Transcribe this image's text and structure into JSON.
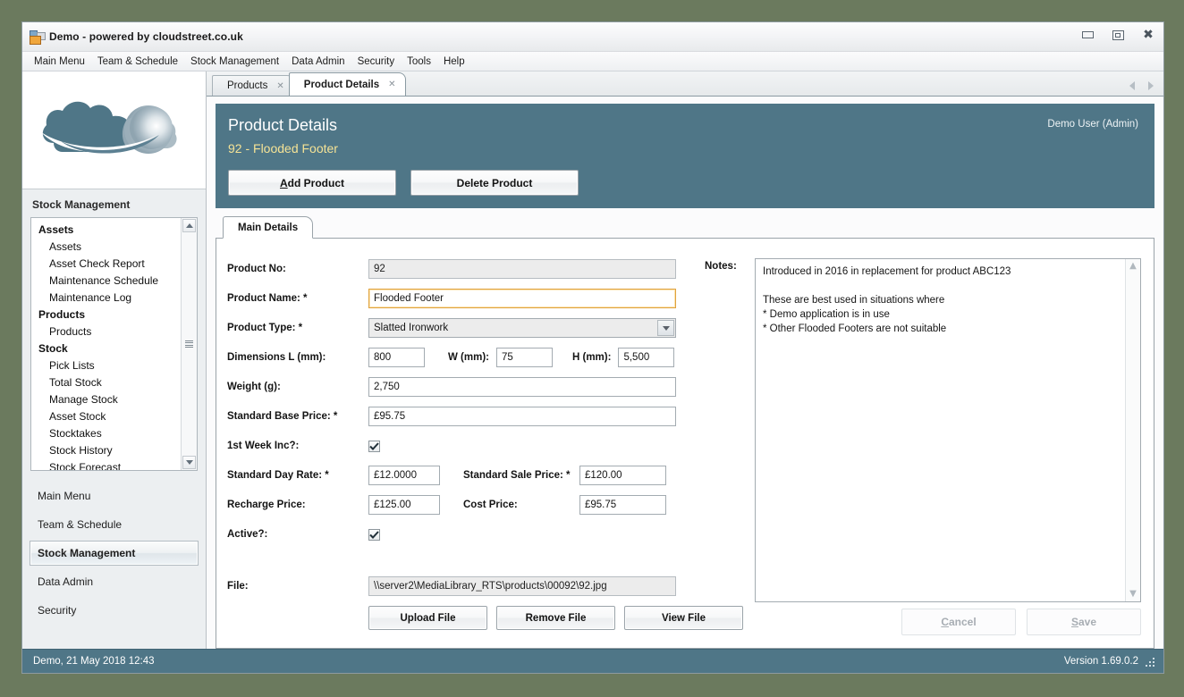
{
  "window": {
    "title": "Demo - powered by cloudstreet.co.uk",
    "app_icon": "app-window-icon",
    "minimize": "minimize-icon",
    "restore": "restore-icon",
    "close": "close-icon"
  },
  "menubar": {
    "items": [
      {
        "label": "Main Menu"
      },
      {
        "label": "Team & Schedule"
      },
      {
        "label": "Stock Management"
      },
      {
        "label": "Data Admin"
      },
      {
        "label": "Security"
      },
      {
        "label": "Tools"
      },
      {
        "label": "Help"
      }
    ]
  },
  "tabs": {
    "items": [
      {
        "label": "Products",
        "active": false,
        "close": "✕"
      },
      {
        "label": "Product Details",
        "active": true,
        "close": "✕"
      }
    ],
    "nav_prev": "chevron-left-icon",
    "nav_next": "chevron-right-icon"
  },
  "sidebar": {
    "logo": "cloudstreet-cloud-logo",
    "section_heading": "Stock Management",
    "tree": [
      {
        "label": "Assets",
        "type": "group"
      },
      {
        "label": "Assets",
        "type": "child"
      },
      {
        "label": "Asset Check Report",
        "type": "child"
      },
      {
        "label": "Maintenance Schedule",
        "type": "child"
      },
      {
        "label": "Maintenance Log",
        "type": "child"
      },
      {
        "label": "Products",
        "type": "group"
      },
      {
        "label": "Products",
        "type": "child"
      },
      {
        "label": "Stock",
        "type": "group"
      },
      {
        "label": "Pick Lists",
        "type": "child"
      },
      {
        "label": "Total Stock",
        "type": "child"
      },
      {
        "label": "Manage Stock",
        "type": "child"
      },
      {
        "label": "Asset Stock",
        "type": "child"
      },
      {
        "label": "Stocktakes",
        "type": "child"
      },
      {
        "label": "Stock History",
        "type": "child"
      },
      {
        "label": "Stock Forecast",
        "type": "child"
      }
    ],
    "nav": [
      {
        "label": "Main Menu",
        "selected": false
      },
      {
        "label": "Team & Schedule",
        "selected": false
      },
      {
        "label": "Stock Management",
        "selected": true
      },
      {
        "label": "Data Admin",
        "selected": false
      },
      {
        "label": "Security",
        "selected": false
      }
    ]
  },
  "header": {
    "title": "Product Details",
    "subtitle": "92 - Flooded Footer",
    "user": "Demo User (Admin)",
    "add_button": "Add Product",
    "add_button_accel": "A",
    "add_button_rest": "dd Product",
    "delete_button": "Delete Product",
    "accent_color": "#4f7687",
    "subtitle_color": "#f5e396"
  },
  "panel": {
    "tab_label": "Main Details"
  },
  "form": {
    "product_no": {
      "label": "Product No:",
      "value": "92"
    },
    "product_name": {
      "label": "Product Name: *",
      "value": "Flooded Footer"
    },
    "product_type": {
      "label": "Product Type: *",
      "value": "Slatted Ironwork"
    },
    "dimensions": {
      "label": "Dimensions L (mm):",
      "length": "800",
      "width_label": "W (mm):",
      "width": "75",
      "height_label": "H (mm):",
      "height": "5,500"
    },
    "weight": {
      "label": "Weight (g):",
      "value": "2,750"
    },
    "base_price": {
      "label": "Standard Base Price: *",
      "value": "£95.75"
    },
    "first_week_inc": {
      "label": "1st Week Inc?:",
      "checked": true
    },
    "day_rate": {
      "label": "Standard Day Rate: *",
      "value": "£12.0000"
    },
    "sale_price": {
      "label": "Standard Sale Price: *",
      "value": "£120.00"
    },
    "recharge_price": {
      "label": "Recharge Price:",
      "value": "£125.00"
    },
    "cost_price": {
      "label": "Cost Price:",
      "value": "£95.75"
    },
    "active": {
      "label": "Active?:",
      "checked": true
    },
    "file": {
      "label": "File:",
      "value": "\\\\server2\\MediaLibrary_RTS\\products\\00092\\92.jpg",
      "upload_button": "Upload File",
      "remove_button": "Remove File",
      "view_button": "View File"
    },
    "notes": {
      "label": "Notes:",
      "value": "Introduced in 2016 in replacement for product ABC123\n\nThese are best used in situations where\n* Demo application is in use\n* Other Flooded Footers are not suitable"
    }
  },
  "footer": {
    "cancel_button": "Cancel",
    "save_button": "Save"
  },
  "statusbar": {
    "left": "Demo, 21 May 2018 12:43",
    "right": "Version 1.69.0.2"
  }
}
